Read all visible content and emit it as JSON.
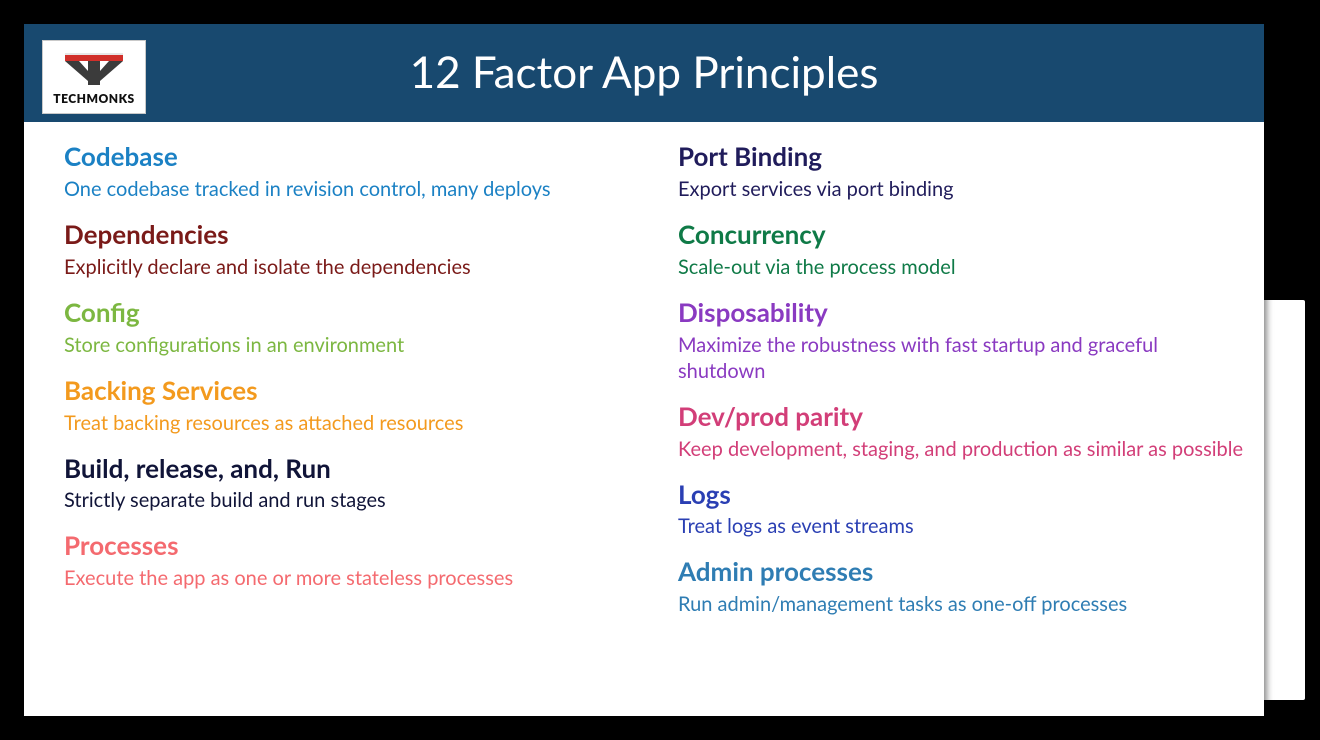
{
  "brand": {
    "name": "TECHMONKS"
  },
  "title": "12 Factor App Principles",
  "principles": [
    {
      "title": "Codebase",
      "desc": "One codebase tracked in revision control, many deploys",
      "color": "#1b81c4"
    },
    {
      "title": "Dependencies",
      "desc": "Explicitly declare and isolate the dependencies",
      "color": "#7a1a18"
    },
    {
      "title": "Config",
      "desc": "Store configurations in an environment",
      "color": "#7cb741"
    },
    {
      "title": "Backing Services",
      "desc": "Treat backing resources as attached resources",
      "color": "#f39a1e"
    },
    {
      "title": "Build, release, and, Run",
      "desc": "Strictly separate build and run stages",
      "color": "#101438"
    },
    {
      "title": "Processes",
      "desc": "Execute the app as one or more stateless processes",
      "color": "#f46a6f"
    },
    {
      "title": "Port Binding",
      "desc": "Export services via port binding",
      "color": "#201c5b"
    },
    {
      "title": "Concurrency",
      "desc": "Scale-out via the process model",
      "color": "#0f7a47"
    },
    {
      "title": "Disposability",
      "desc": "Maximize the robustness with fast startup and graceful shutdown",
      "color": "#8a3ac1"
    },
    {
      "title": "Dev/prod parity",
      "desc": "Keep development, staging, and production as similar as possible",
      "color": "#d23e78"
    },
    {
      "title": "Logs",
      "desc": "Treat logs as event streams",
      "color": "#2a3fb3"
    },
    {
      "title": "Admin processes",
      "desc": "Run admin/management tasks as one-off processes",
      "color": "#2f7db3"
    }
  ]
}
